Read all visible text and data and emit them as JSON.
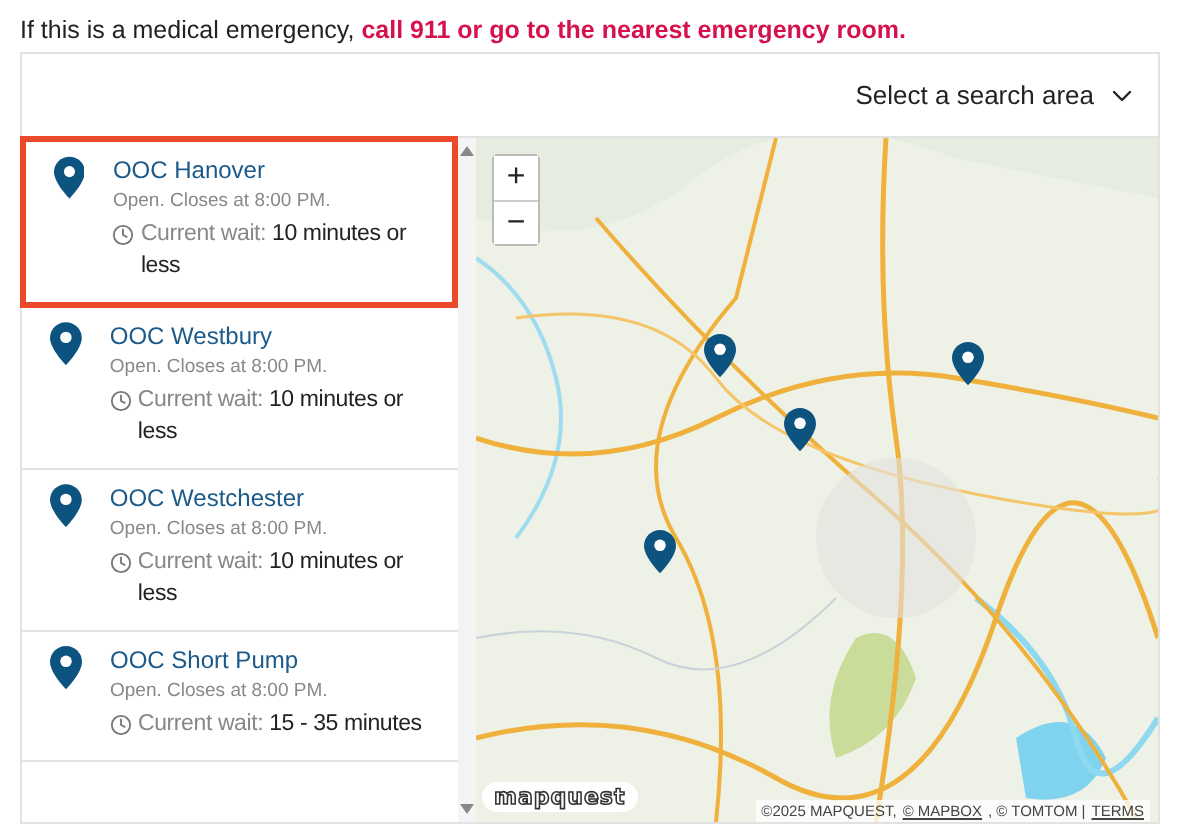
{
  "notice": {
    "text": "If this is a medical emergency,",
    "link": "call 911 or go to the nearest emergency room."
  },
  "search_area": {
    "label": "Select a search area"
  },
  "locations": [
    {
      "name": "OOC Hanover",
      "hours": "Open. Closes at 8:00 PM.",
      "wait_label": "Current wait:",
      "wait": "10 minutes or less",
      "selected": true
    },
    {
      "name": "OOC Westbury",
      "hours": "Open. Closes at 8:00 PM.",
      "wait_label": "Current wait:",
      "wait": "10 minutes or less",
      "selected": false
    },
    {
      "name": "OOC Westchester",
      "hours": "Open. Closes at 8:00 PM.",
      "wait_label": "Current wait:",
      "wait": "10 minutes or less",
      "selected": false
    },
    {
      "name": "OOC Short Pump",
      "hours": "Open. Closes at 8:00 PM.",
      "wait_label": "Current wait:",
      "wait": "15 - 35 minutes",
      "selected": false
    }
  ],
  "map": {
    "zoom_in": "+",
    "zoom_out": "−",
    "logo": "mapquest",
    "attribution": [
      {
        "text": "©2025 MAPQUEST,",
        "link": false
      },
      {
        "text": "© MAPBOX",
        "link": true
      },
      {
        "text": ", © TOMTOM |",
        "link": false
      },
      {
        "text": "TERMS",
        "link": true
      }
    ]
  }
}
